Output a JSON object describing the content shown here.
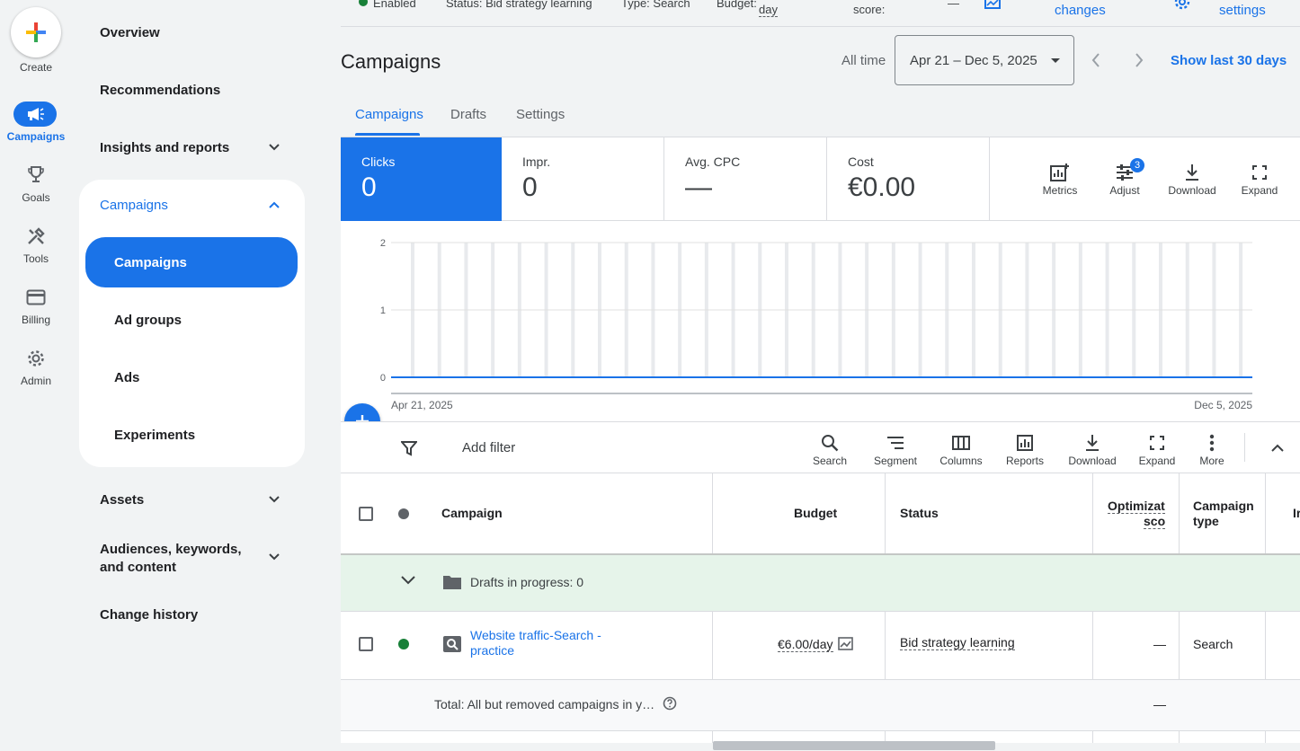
{
  "rail": {
    "create": "Create",
    "items": [
      {
        "label": "Campaigns",
        "icon": "megaphone-icon",
        "active": true
      },
      {
        "label": "Goals",
        "icon": "trophy-icon"
      },
      {
        "label": "Tools",
        "icon": "tools-icon"
      },
      {
        "label": "Billing",
        "icon": "credit-card-icon"
      },
      {
        "label": "Admin",
        "icon": "gear-icon"
      }
    ]
  },
  "nav": {
    "overview": "Overview",
    "recommendations": "Recommendations",
    "insights": "Insights and reports",
    "campaigns_group": "Campaigns",
    "sub": [
      "Campaigns",
      "Ad groups",
      "Ads",
      "Experiments"
    ],
    "assets": "Assets",
    "audiences": "Audiences, keywords, and content",
    "change_history": "Change history"
  },
  "topstrip": {
    "enabled": "Enabled",
    "status": "Status: Bid strategy learning",
    "type": "Type: Search",
    "budget": "Budget:",
    "budget_unit": "day",
    "score": "score:",
    "score_value": "—",
    "changes": "changes",
    "settings": "settings"
  },
  "header": {
    "title": "Campaigns",
    "all_time": "All time",
    "date_range": "Apr 21 – Dec 5, 2025",
    "show_last": "Show last 30 days"
  },
  "tabs": [
    "Campaigns",
    "Drafts",
    "Settings"
  ],
  "scorecards": [
    {
      "label": "Clicks",
      "value": "0"
    },
    {
      "label": "Impr.",
      "value": "0"
    },
    {
      "label": "Avg. CPC",
      "value": "—"
    },
    {
      "label": "Cost",
      "value": "€0.00"
    }
  ],
  "card_tools": {
    "metrics": "Metrics",
    "adjust": "Adjust",
    "adjust_badge": "3",
    "download": "Download",
    "expand": "Expand"
  },
  "chart_data": {
    "type": "line",
    "x_start": "Apr 21, 2025",
    "x_end": "Dec 5, 2025",
    "yticks": [
      "0",
      "1",
      "2"
    ],
    "ylim": [
      0,
      2
    ],
    "series": [
      {
        "values": [
          0,
          0
        ]
      }
    ],
    "grid": true,
    "colors": {
      "line": "#1a73e8",
      "bars": "#e8eaed"
    }
  },
  "toolbar": {
    "add_filter": "Add filter",
    "buttons": [
      "Search",
      "Segment",
      "Columns",
      "Reports",
      "Download",
      "Expand",
      "More"
    ]
  },
  "table": {
    "headers": {
      "campaign": "Campaign",
      "budget": "Budget",
      "status": "Status",
      "optimization": "Optimizati",
      "optimization2": "sco",
      "campaign_type": "Campaign",
      "campaign_type2": "type",
      "extra": "Ir"
    },
    "drafts": "Drafts in progress: 0",
    "row": {
      "name_line1": "Website traffic-Search -",
      "name_line2": "practice",
      "budget": "€6.00/day",
      "status": "Bid strategy learning",
      "optimization": "—",
      "type": "Search"
    },
    "total": {
      "label": "Total: All but removed campaigns in y…",
      "optimization": "—"
    }
  }
}
